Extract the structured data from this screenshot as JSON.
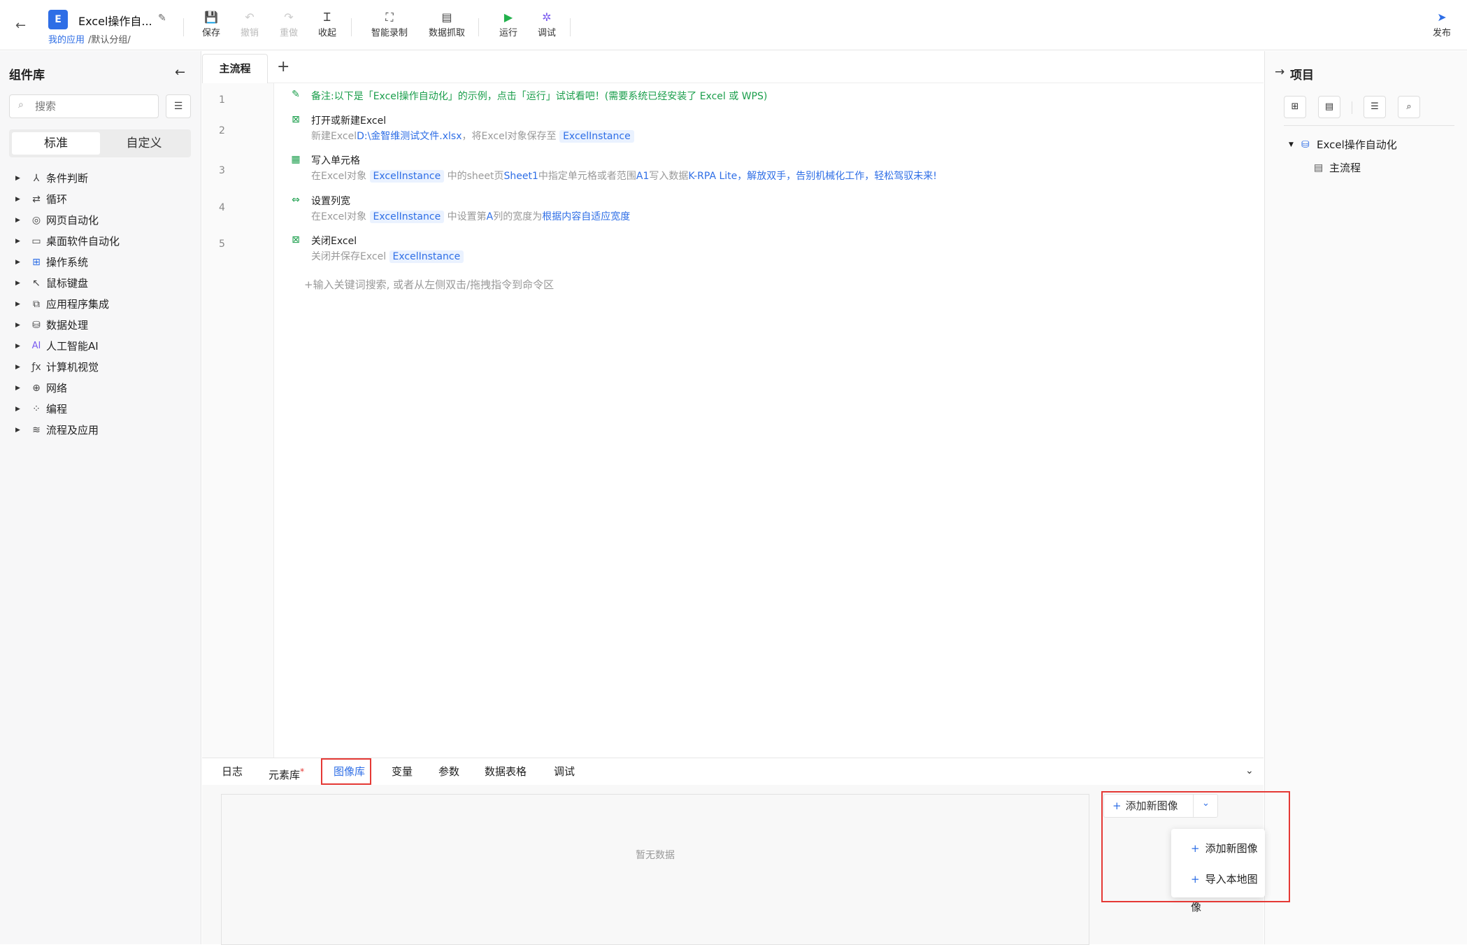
{
  "header": {
    "app_icon_letter": "E",
    "app_title": "Excel操作自...",
    "breadcrumb_link": "我的应用",
    "breadcrumb_rest": "/默认分组/",
    "toolbar": {
      "save": "保存",
      "undo": "撤销",
      "redo": "重做",
      "collapse": "收起",
      "smart_record": "智能录制",
      "data_capture": "数据抓取",
      "run": "运行",
      "debug": "调试",
      "publish": "发布"
    }
  },
  "left_panel": {
    "title": "组件库",
    "search_placeholder": "搜索",
    "tabs": [
      "标准",
      "自定义"
    ],
    "categories": [
      {
        "label": "条件判断",
        "icon": "branch-icon"
      },
      {
        "label": "循环",
        "icon": "loop-icon"
      },
      {
        "label": "网页自动化",
        "icon": "browser-icon"
      },
      {
        "label": "桌面软件自动化",
        "icon": "desktop-icon"
      },
      {
        "label": "操作系统",
        "icon": "windows-icon"
      },
      {
        "label": "鼠标键盘",
        "icon": "mouse-pointer-icon"
      },
      {
        "label": "应用程序集成",
        "icon": "app-integration-icon"
      },
      {
        "label": "数据处理",
        "icon": "database-icon"
      },
      {
        "label": "人工智能AI",
        "icon": "ai-icon"
      },
      {
        "label": "计算机视觉",
        "icon": "function-icon"
      },
      {
        "label": "网络",
        "icon": "globe-icon"
      },
      {
        "label": "编程",
        "icon": "code-blocks-icon"
      },
      {
        "label": "流程及应用",
        "icon": "layers-icon"
      }
    ]
  },
  "editor": {
    "tab": "主流程",
    "add_tab": "+",
    "line_numbers": [
      "1",
      "2",
      "3",
      "4",
      "5"
    ],
    "note": "备注:以下是「Excel操作自动化」的示例，点击「运行」试试看吧！(需要系统已经安装了 Excel 或 WPS)",
    "steps": [
      {
        "title": "打开或新建Excel",
        "desc_prefix": "新建Excel",
        "desc_path": "D:\\金智维测试文件.xlsx",
        "desc_mid": "，将Excel对象保存至",
        "var": "ExcelInstance"
      },
      {
        "title": "写入单元格",
        "desc_prefix": "在Excel对象",
        "var": "ExcelInstance",
        "desc_mid1": "中的sheet页",
        "sheet": "Sheet1",
        "desc_mid2": "中指定单元格或者范围",
        "range": "A1",
        "desc_mid3": "写入数据",
        "data": "K-RPA Lite，解放双手，告别机械化工作，轻松驾驭未来!"
      },
      {
        "title": "设置列宽",
        "desc_prefix": "在Excel对象",
        "var": "ExcelInstance",
        "desc_mid1": "中设置第",
        "col": "A",
        "desc_mid2": "列的宽度为",
        "mode": "根据内容自适应宽度"
      },
      {
        "title": "关闭Excel",
        "desc_prefix": "关闭并保存Excel",
        "var": "ExcelInstance"
      }
    ],
    "input_hint": "+输入关键词搜索, 或者从左侧双击/拖拽指令到命令区"
  },
  "right_panel": {
    "title": "项目",
    "tree_root": "Excel操作自动化",
    "tree_child": "主流程"
  },
  "bottom_panel": {
    "tabs": [
      "日志",
      "元素库",
      "图像库",
      "变量",
      "参数",
      "数据表格",
      "调试"
    ],
    "active_tab": "图像库",
    "required_mark": "*",
    "empty_text": "暂无数据",
    "add_image_button": "添加新图像",
    "dropdown": [
      "添加新图像",
      "导入本地图像"
    ]
  },
  "colors": {
    "accent": "#2e6ee6",
    "note_green": "#1a9e4b",
    "highlight_red": "#e53935",
    "run_green": "#22b14c",
    "debug_purple": "#7b5cf0"
  }
}
